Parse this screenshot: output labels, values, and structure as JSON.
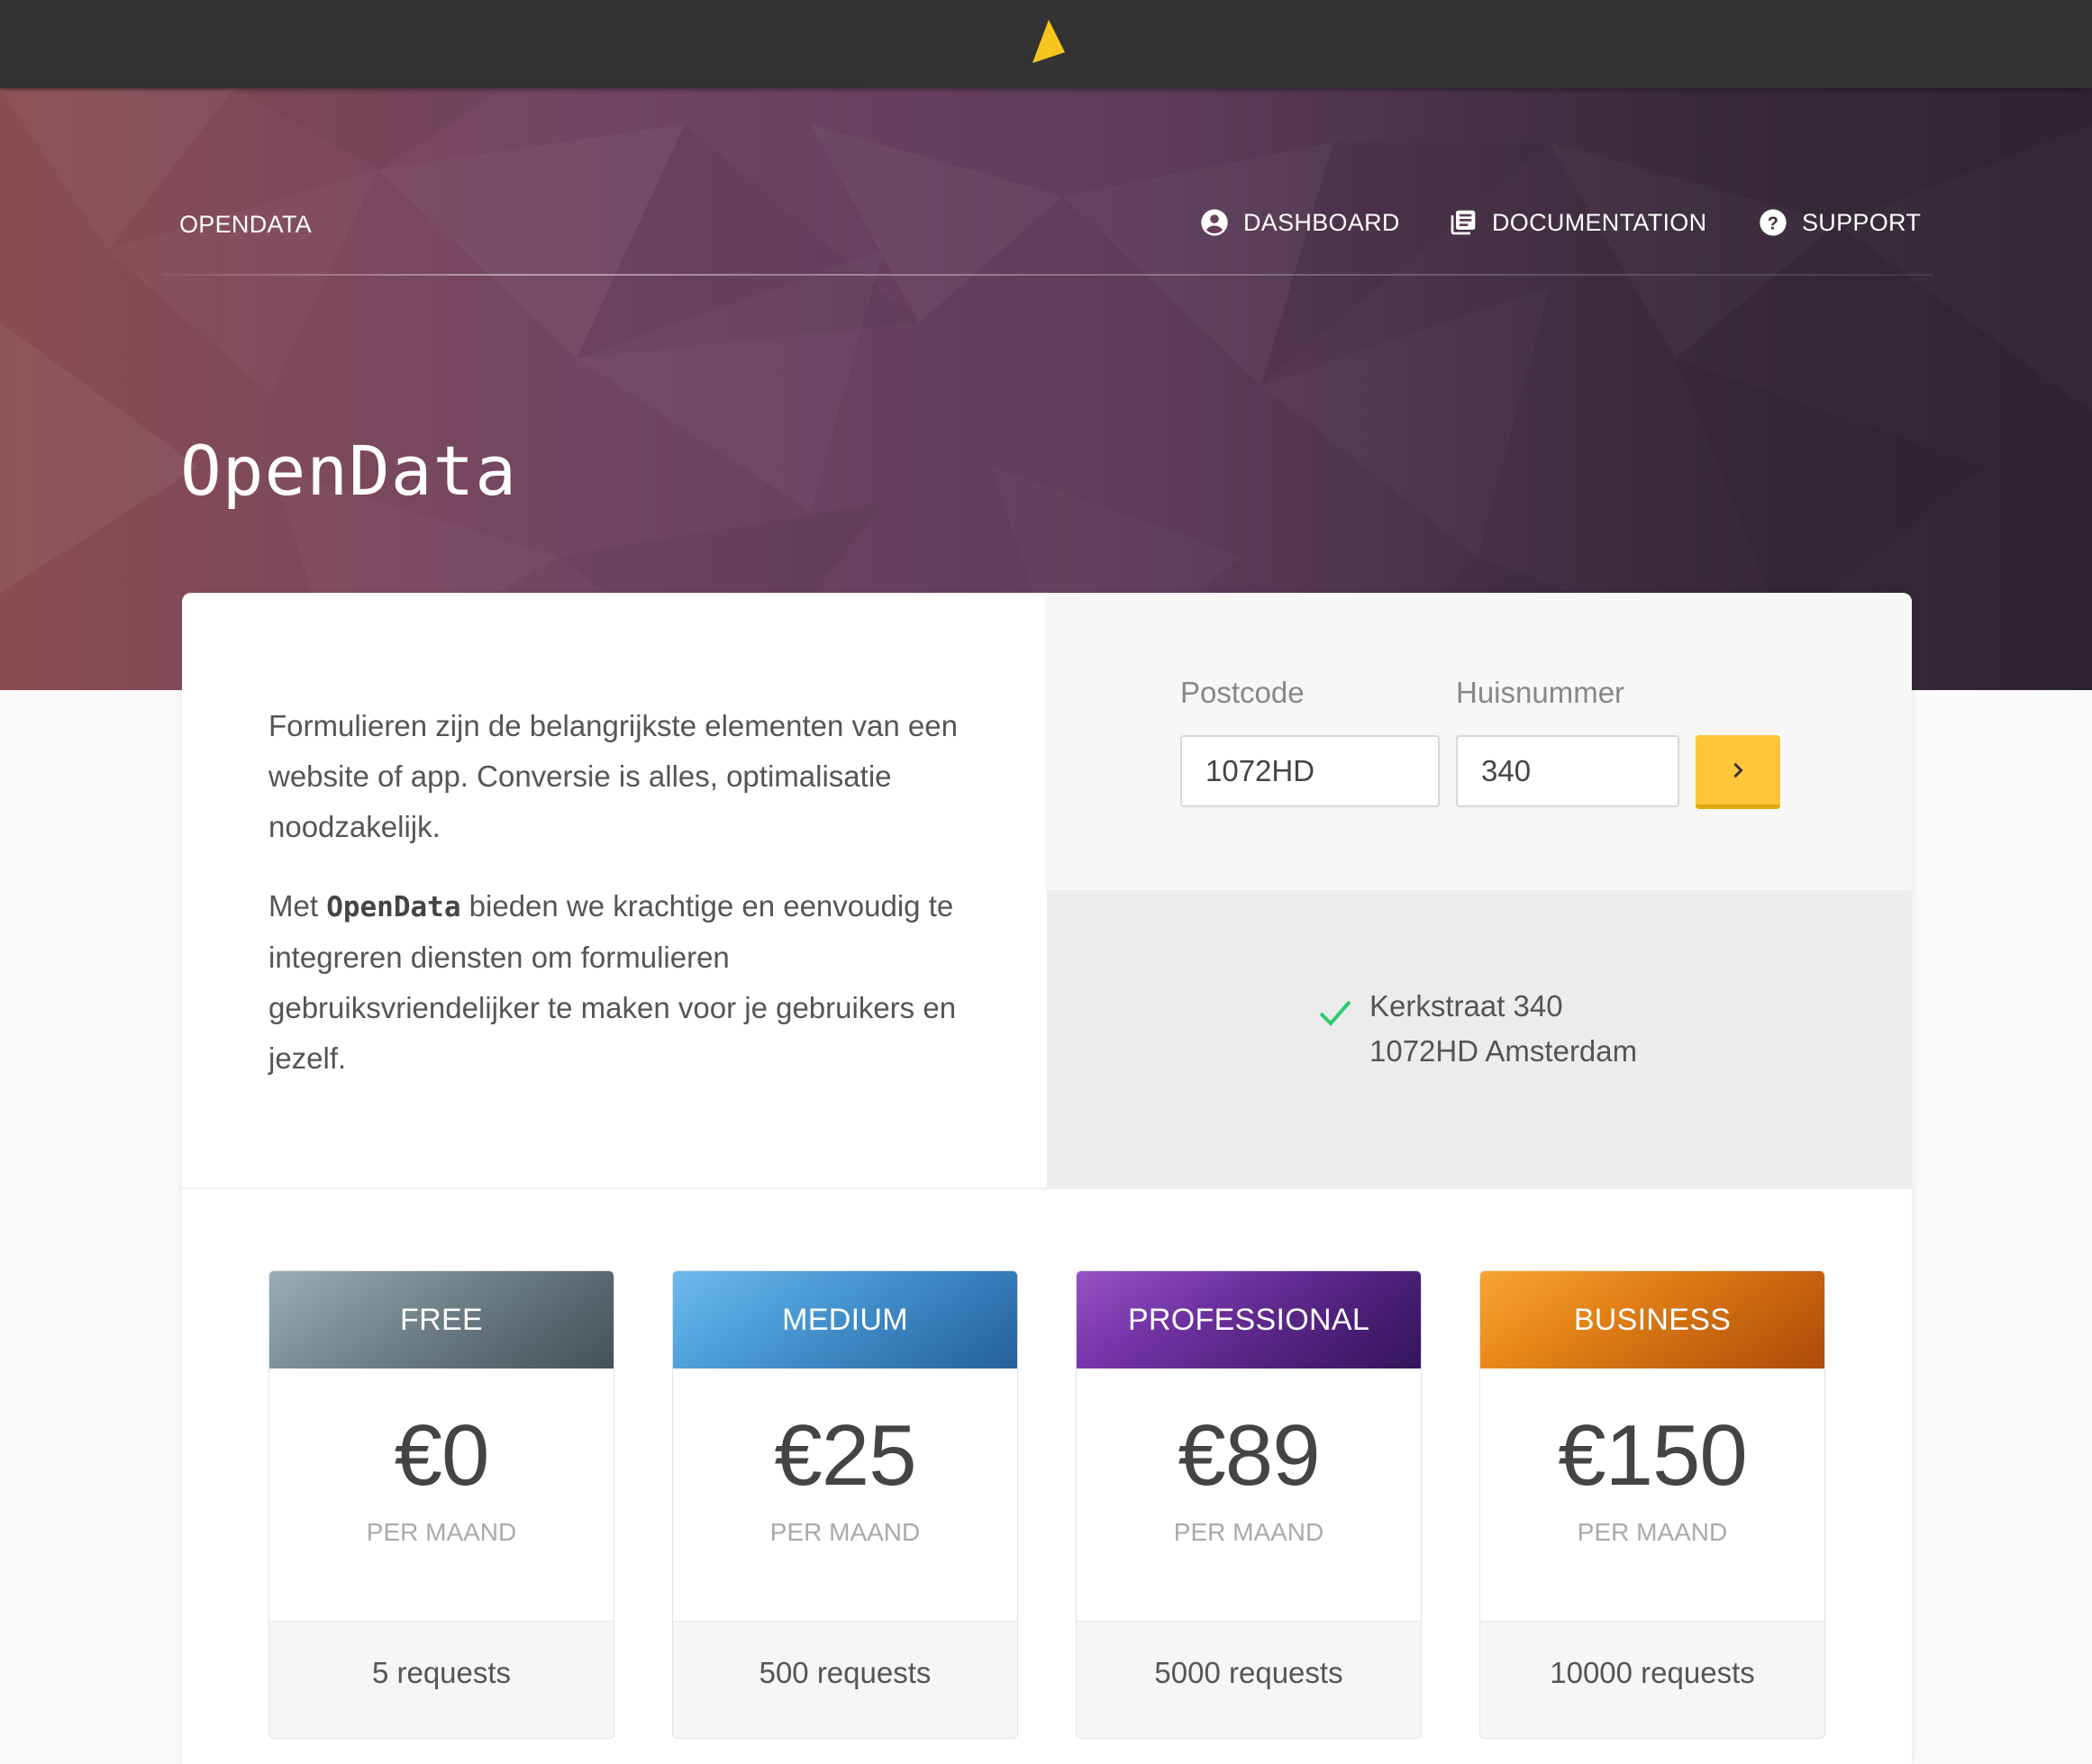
{
  "nav": {
    "brand": "OPENDATA",
    "items": [
      {
        "label": "DASHBOARD",
        "icon": "account-circle-icon"
      },
      {
        "label": "DOCUMENTATION",
        "icon": "library-books-icon"
      },
      {
        "label": "SUPPORT",
        "icon": "help-circle-icon"
      }
    ]
  },
  "hero": {
    "title": "OpenData"
  },
  "intro": {
    "paragraph1": "Formulieren zijn de belangrijkste elementen van een website of app. Conversie is alles, optimalisatie noodzakelijk.",
    "p2_before": "Met ",
    "p2_brand": "OpenData",
    "p2_after": " bieden we krachtige en eenvoudig te integreren diensten om formulieren gebruiksvriendelijker te maken voor je gebruikers en jezelf."
  },
  "form": {
    "postcode_label": "Postcode",
    "postcode_value": "1072HD",
    "huisnummer_label": "Huisnummer",
    "huisnummer_value": "340",
    "submit_icon": "chevron-right-icon"
  },
  "result": {
    "icon": "check-icon",
    "line1": "Kerkstraat 340",
    "line2": "1072HD Amsterdam",
    "check_color": "#2ecc71"
  },
  "plans": [
    {
      "name": "FREE",
      "price": "€0",
      "period": "PER MAAND",
      "requests": "5 requests",
      "color": "#6a7f8a"
    },
    {
      "name": "MEDIUM",
      "price": "€25",
      "period": "PER MAAND",
      "requests": "500 requests",
      "color": "#3c93d6"
    },
    {
      "name": "PROFESSIONAL",
      "price": "€89",
      "period": "PER MAAND",
      "requests": "5000 requests",
      "color": "#5b2c9a"
    },
    {
      "name": "BUSINESS",
      "price": "€150",
      "period": "PER MAAND",
      "requests": "10000 requests",
      "color": "#e8750f"
    }
  ],
  "colors": {
    "topbar": "#333333",
    "accent_button": "#fdc63a",
    "logo": "#f7c51e"
  }
}
